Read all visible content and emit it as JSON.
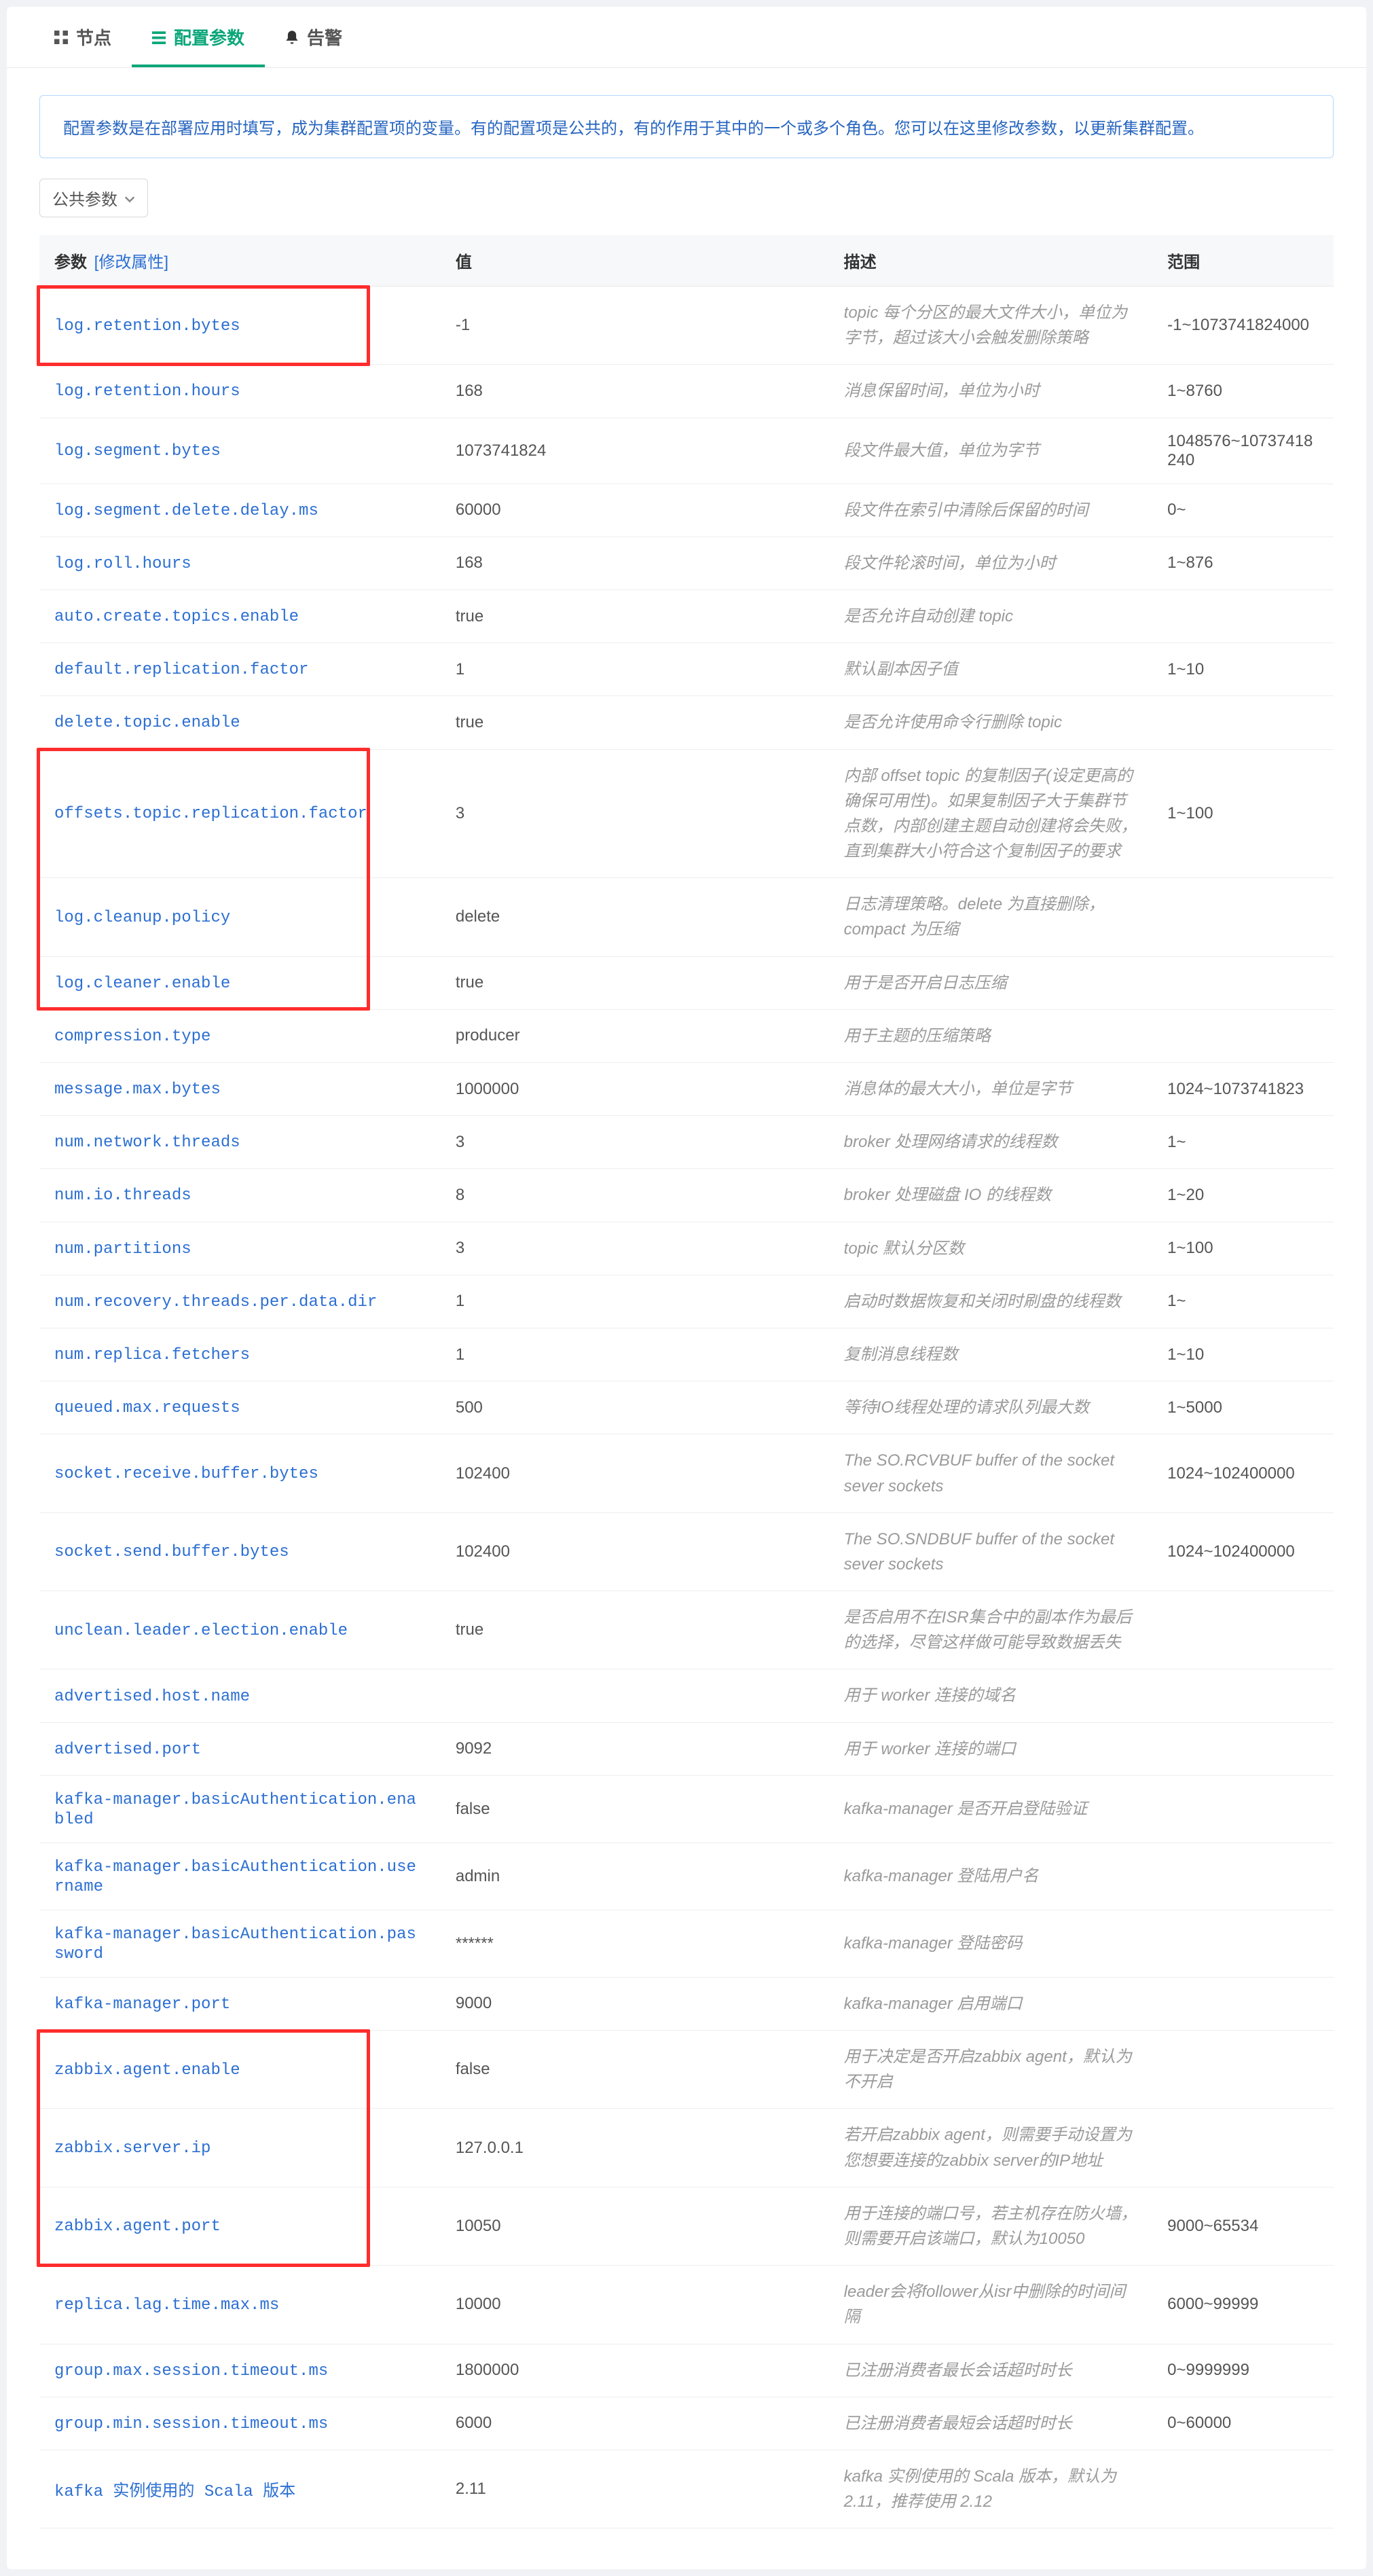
{
  "tabs": {
    "nodes": "节点",
    "config": "配置参数",
    "alerts": "告警"
  },
  "banner": "配置参数是在部署应用时填写，成为集群配置项的变量。有的配置项是公共的，有的作用于其中的一个或多个角色。您可以在这里修改参数，以更新集群配置。",
  "scope_selector": "公共参数",
  "columns": {
    "param": "参数",
    "modify": "[修改属性]",
    "value": "值",
    "desc": "描述",
    "range": "范围"
  },
  "rows": [
    {
      "name": "log.retention.bytes",
      "value": "-1",
      "desc": "topic 每个分区的最大文件大小，单位为字节，超过该大小会触发删除策略",
      "range": "-1~1073741824000"
    },
    {
      "name": "log.retention.hours",
      "value": "168",
      "desc": "消息保留时间，单位为小时",
      "range": "1~8760"
    },
    {
      "name": "log.segment.bytes",
      "value": "1073741824",
      "desc": "段文件最大值，单位为字节",
      "range": "1048576~10737418240"
    },
    {
      "name": "log.segment.delete.delay.ms",
      "value": "60000",
      "desc": "段文件在索引中清除后保留的时间",
      "range": "0~"
    },
    {
      "name": "log.roll.hours",
      "value": "168",
      "desc": "段文件轮滚时间，单位为小时",
      "range": "1~876"
    },
    {
      "name": "auto.create.topics.enable",
      "value": "true",
      "desc": "是否允许自动创建 topic",
      "range": ""
    },
    {
      "name": "default.replication.factor",
      "value": "1",
      "desc": "默认副本因子值",
      "range": "1~10"
    },
    {
      "name": "delete.topic.enable",
      "value": "true",
      "desc": "是否允许使用命令行删除 topic",
      "range": ""
    },
    {
      "name": "offsets.topic.replication.factor",
      "value": "3",
      "desc": "内部 offset topic 的复制因子(设定更高的确保可用性)。如果复制因子大于集群节点数，内部创建主题自动创建将会失败，直到集群大小符合这个复制因子的要求",
      "range": "1~100"
    },
    {
      "name": "log.cleanup.policy",
      "value": "delete",
      "desc": "日志清理策略。delete 为直接删除，compact 为压缩",
      "range": ""
    },
    {
      "name": "log.cleaner.enable",
      "value": "true",
      "desc": "用于是否开启日志压缩",
      "range": ""
    },
    {
      "name": "compression.type",
      "value": "producer",
      "desc": "用于主题的压缩策略",
      "range": ""
    },
    {
      "name": "message.max.bytes",
      "value": "1000000",
      "desc": "消息体的最大大小，单位是字节",
      "range": "1024~1073741823"
    },
    {
      "name": "num.network.threads",
      "value": "3",
      "desc": "broker 处理网络请求的线程数",
      "range": "1~"
    },
    {
      "name": "num.io.threads",
      "value": "8",
      "desc": "broker 处理磁盘 IO 的线程数",
      "range": "1~20"
    },
    {
      "name": "num.partitions",
      "value": "3",
      "desc": "topic 默认分区数",
      "range": "1~100"
    },
    {
      "name": "num.recovery.threads.per.data.dir",
      "value": "1",
      "desc": "启动时数据恢复和关闭时刷盘的线程数",
      "range": "1~"
    },
    {
      "name": "num.replica.fetchers",
      "value": "1",
      "desc": "复制消息线程数",
      "range": "1~10"
    },
    {
      "name": "queued.max.requests",
      "value": "500",
      "desc": "等待IO线程处理的请求队列最大数",
      "range": "1~5000"
    },
    {
      "name": "socket.receive.buffer.bytes",
      "value": "102400",
      "desc": "The SO.RCVBUF buffer of the socket sever sockets",
      "range": "1024~102400000"
    },
    {
      "name": "socket.send.buffer.bytes",
      "value": "102400",
      "desc": "The SO.SNDBUF buffer of the socket sever sockets",
      "range": "1024~102400000"
    },
    {
      "name": "unclean.leader.election.enable",
      "value": "true",
      "desc": "是否启用不在ISR集合中的副本作为最后的选择，尽管这样做可能导致数据丢失",
      "range": ""
    },
    {
      "name": "advertised.host.name",
      "value": "",
      "desc": "用于 worker 连接的域名",
      "range": ""
    },
    {
      "name": "advertised.port",
      "value": "9092",
      "desc": "用于 worker 连接的端口",
      "range": ""
    },
    {
      "name": "kafka-manager.basicAuthentication.enabled",
      "value": "false",
      "desc": "kafka-manager 是否开启登陆验证",
      "range": ""
    },
    {
      "name": "kafka-manager.basicAuthentication.username",
      "value": "admin",
      "desc": "kafka-manager 登陆用户名",
      "range": ""
    },
    {
      "name": "kafka-manager.basicAuthentication.password",
      "value": "******",
      "desc": "kafka-manager 登陆密码",
      "range": ""
    },
    {
      "name": "kafka-manager.port",
      "value": "9000",
      "desc": "kafka-manager 启用端口",
      "range": ""
    },
    {
      "name": "zabbix.agent.enable",
      "value": "false",
      "desc": "用于决定是否开启zabbix agent，默认为不开启",
      "range": ""
    },
    {
      "name": "zabbix.server.ip",
      "value": "127.0.0.1",
      "desc": "若开启zabbix agent，则需要手动设置为您想要连接的zabbix server的IP地址",
      "range": ""
    },
    {
      "name": "zabbix.agent.port",
      "value": "10050",
      "desc": "用于连接的端口号，若主机存在防火墙，则需要开启该端口，默认为10050",
      "range": "9000~65534"
    },
    {
      "name": "replica.lag.time.max.ms",
      "value": "10000",
      "desc": "leader会将follower从isr中删除的时间间隔",
      "range": "6000~99999"
    },
    {
      "name": "group.max.session.timeout.ms",
      "value": "1800000",
      "desc": "已注册消费者最长会话超时时长",
      "range": "0~9999999"
    },
    {
      "name": "group.min.session.timeout.ms",
      "value": "6000",
      "desc": "已注册消费者最短会话超时时长",
      "range": "0~60000"
    },
    {
      "name": "kafka 实例使用的 Scala 版本",
      "value": "2.11",
      "desc": "kafka 实例使用的 Scala 版本，默认为 2.11，推荐使用 2.12",
      "range": ""
    }
  ]
}
